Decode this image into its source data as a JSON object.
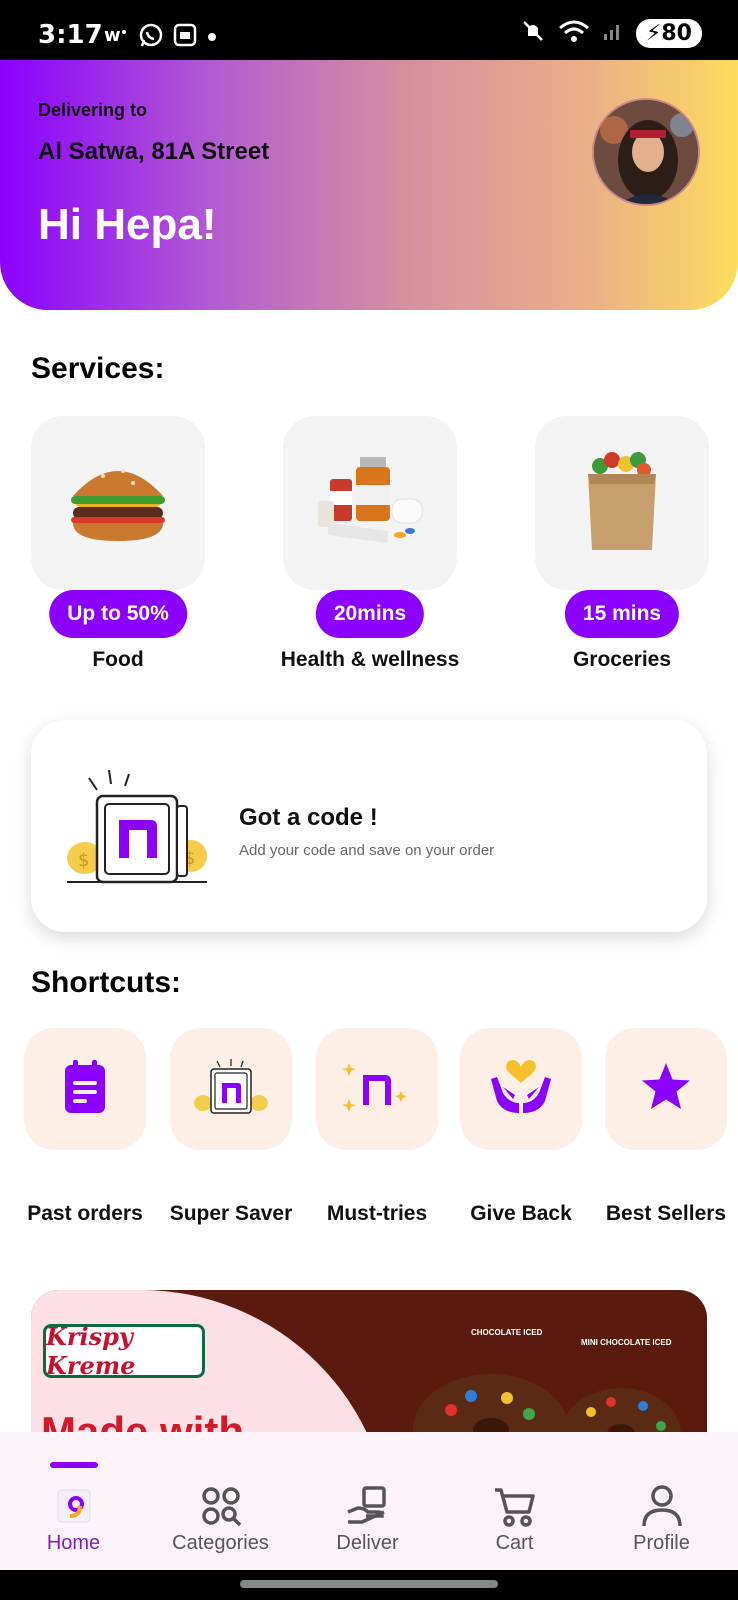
{
  "status_bar": {
    "time": "3:17",
    "battery": "80",
    "left_icons": [
      "wechat-icon",
      "whatsapp-icon",
      "screenshot-icon",
      "dot-icon"
    ],
    "right_icons": [
      "mute-icon",
      "wifi-icon",
      "signal-icon",
      "battery-icon"
    ]
  },
  "header": {
    "delivering_label": "Delivering to",
    "address": "Al Satwa, 81A Street",
    "greeting": "Hi Hepa!",
    "gradient": [
      "#8b00ff",
      "#fddc5c"
    ]
  },
  "services": {
    "title": "Services:",
    "items": [
      {
        "badge": "Up to 50%",
        "label": "Food",
        "icon": "burger-icon"
      },
      {
        "badge": "20mins",
        "label": "Health & wellness",
        "icon": "medicine-icon"
      },
      {
        "badge": "15 mins",
        "label": "Groceries",
        "icon": "grocery-bag-icon"
      }
    ]
  },
  "code_card": {
    "title": "Got a code !",
    "subtitle": "Add your code and save on your order"
  },
  "shortcuts": {
    "title": "Shortcuts:",
    "items": [
      {
        "label": "Past orders",
        "icon": "clipboard-icon"
      },
      {
        "label": "Super Saver",
        "icon": "safe-icon"
      },
      {
        "label": "Must-tries",
        "icon": "sparkle-n-icon"
      },
      {
        "label": "Give Back",
        "icon": "heart-hands-icon"
      },
      {
        "label": "Best Sellers",
        "icon": "star-icon"
      }
    ]
  },
  "banner": {
    "brand": "Krispy Kreme",
    "headline": "Made with",
    "tag1": "CHOCOLATE ICED",
    "tag2": "MINI CHOCOLATE ICED"
  },
  "bottom_nav": {
    "items": [
      {
        "label": "Home",
        "active": true
      },
      {
        "label": "Categories",
        "active": false
      },
      {
        "label": "Deliver",
        "active": false
      },
      {
        "label": "Cart",
        "active": false
      },
      {
        "label": "Profile",
        "active": false
      }
    ]
  },
  "colors": {
    "accent": "#8b00ff",
    "tile_bg": "#f3f3f3",
    "shortcut_bg": "#fdeee6"
  }
}
